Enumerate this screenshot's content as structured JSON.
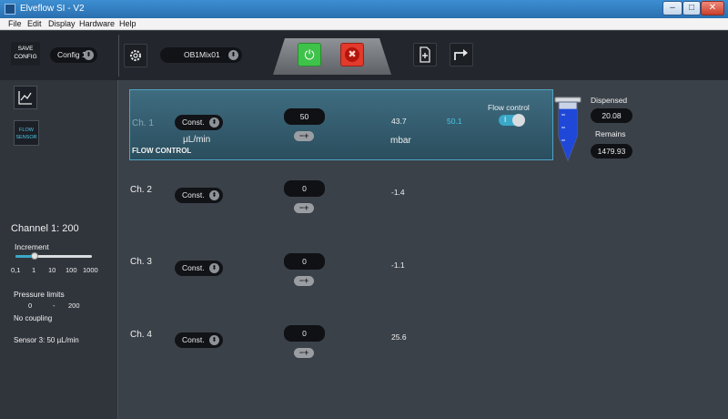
{
  "window": {
    "title": "Elveflow SI - V2",
    "minimize": "–",
    "maximize": "□",
    "close": "✕"
  },
  "menu": [
    "File",
    "Edit",
    "Display",
    "Hardware",
    "Help"
  ],
  "toolbar": {
    "save_config": [
      "SAVE",
      "CONFIG"
    ],
    "config_select": "Config 1",
    "instrument_select": "OB1Mix01",
    "power_icon": "⏻",
    "stop_icon": "✖"
  },
  "sidebar": {
    "flow_sensor": [
      "FLOW",
      "SENSOR"
    ],
    "channel_title": "Channel 1: 200",
    "increment_label": "Increment",
    "increment_level": 0.25,
    "increment_ticks": [
      "0,1",
      "1",
      "10",
      "100",
      "1000"
    ],
    "pressure_limits_label": "Pressure limits",
    "pressure_min": "0",
    "pressure_sep": "-",
    "pressure_max": "200",
    "coupling": "No coupling",
    "sensor": "Sensor 3: 50 µL/min"
  },
  "channels": [
    {
      "label": "Ch. 1",
      "mode": "Const.",
      "setpoint": "50",
      "reading": "43.7",
      "secondary": "50.1",
      "unit_flow": "µL/min",
      "unit_pressure": "mbar",
      "footer": "FLOW CONTROL"
    },
    {
      "label": "Ch. 2",
      "mode": "Const.",
      "setpoint": "0",
      "reading": "-1.4"
    },
    {
      "label": "Ch. 3",
      "mode": "Const.",
      "setpoint": "0",
      "reading": "-1.1"
    },
    {
      "label": "Ch. 4",
      "mode": "Const.",
      "setpoint": "0",
      "reading": "25.6"
    }
  ],
  "flow_control": {
    "label": "Flow control",
    "toggle_mark": "I",
    "enabled": true
  },
  "reservoir": {
    "dispensed_label": "Dispensed",
    "dispensed_value": "20.08",
    "remains_label": "Remains",
    "remains_value": "1479.93",
    "fill_level": 0.8
  },
  "stepper_symbols": "−+",
  "select_arrow": "⬍",
  "colors": {
    "accent": "#3aa8c8",
    "active_row": "#3f6c80",
    "go": "#3fc24a",
    "stop": "#e23a2c",
    "tube": "#1f48d8"
  }
}
